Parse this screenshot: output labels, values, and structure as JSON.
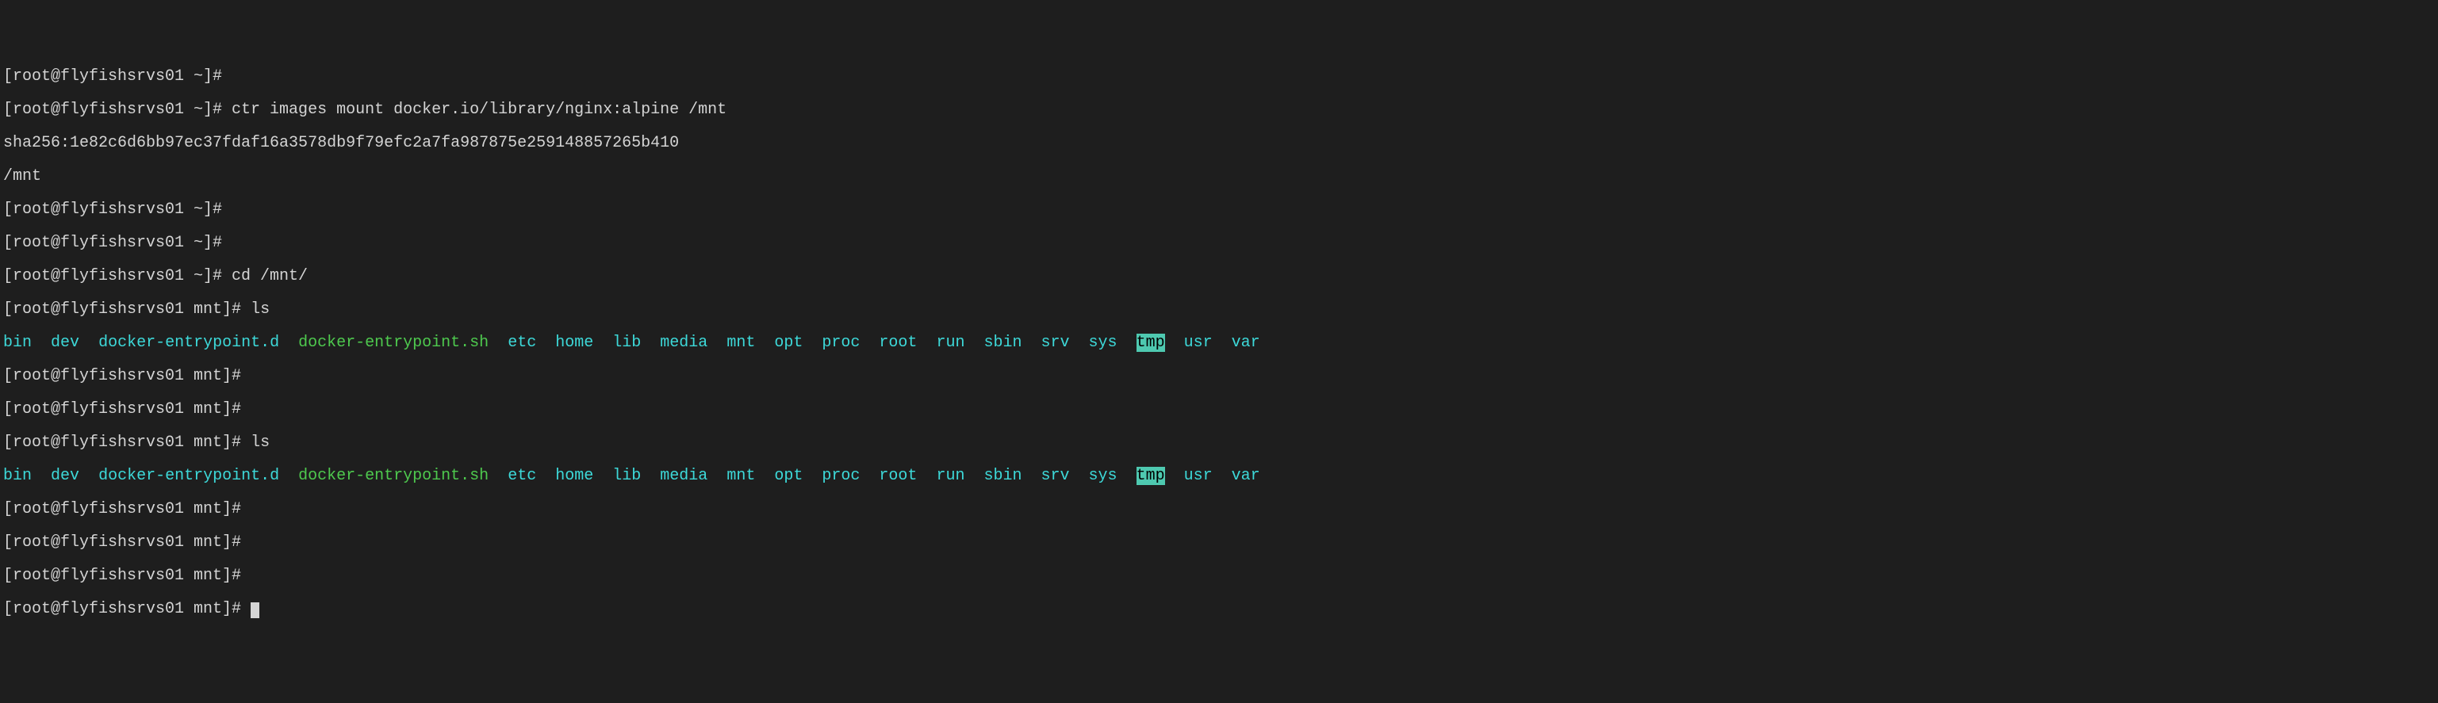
{
  "lines": {
    "l1": "[root@flyfishsrvs01 ~]#",
    "l2_prompt": "[root@flyfishsrvs01 ~]# ",
    "l2_cmd": "ctr images mount docker.io/library/nginx:alpine /mnt",
    "l3": "sha256:1e82c6d6bb97ec37fdaf16a3578db9f79efc2a7fa987875e259148857265b410",
    "l4": "/mnt",
    "l5": "[root@flyfishsrvs01 ~]#",
    "l6": "[root@flyfishsrvs01 ~]#",
    "l7_prompt": "[root@flyfishsrvs01 ~]# ",
    "l7_cmd": "cd /mnt/",
    "l8_prompt": "[root@flyfishsrvs01 mnt]# ",
    "l8_cmd": "ls",
    "l10": "[root@flyfishsrvs01 mnt]#",
    "l11": "[root@flyfishsrvs01 mnt]#",
    "l12_prompt": "[root@flyfishsrvs01 mnt]# ",
    "l12_cmd": "ls",
    "l14": "[root@flyfishsrvs01 mnt]#",
    "l15": "[root@flyfishsrvs01 mnt]#",
    "l16": "[root@flyfishsrvs01 mnt]#",
    "l17": "[root@flyfishsrvs01 mnt]# "
  },
  "ls": {
    "bin": "bin",
    "dev": "dev",
    "docker_d": "docker-entrypoint.d",
    "docker_sh": "docker-entrypoint.sh",
    "etc": "etc",
    "home": "home",
    "lib": "lib",
    "media": "media",
    "mnt": "mnt",
    "opt": "opt",
    "proc": "proc",
    "root": "root",
    "run": "run",
    "sbin": "sbin",
    "srv": "srv",
    "sys": "sys",
    "tmp": "tmp",
    "usr": "usr",
    "var": "var"
  }
}
